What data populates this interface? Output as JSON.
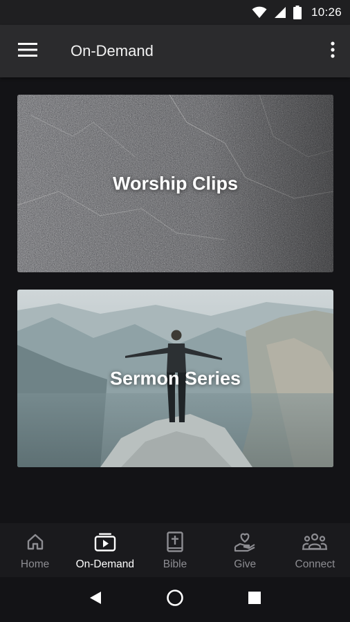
{
  "status_bar": {
    "time": "10:26",
    "icons": [
      "wifi-icon",
      "signal-icon",
      "battery-icon"
    ]
  },
  "app_bar": {
    "title": "On-Demand",
    "menu_icon": "hamburger-menu-icon",
    "overflow_icon": "more-vertical-icon"
  },
  "cards": [
    {
      "title": "Worship Clips"
    },
    {
      "title": "Sermon Series"
    }
  ],
  "bottom_nav": {
    "active": "On-Demand",
    "items": [
      {
        "label": "Home",
        "icon": "home-icon"
      },
      {
        "label": "On-Demand",
        "icon": "video-library-icon"
      },
      {
        "label": "Bible",
        "icon": "bible-icon"
      },
      {
        "label": "Give",
        "icon": "give-heart-hand-icon"
      },
      {
        "label": "Connect",
        "icon": "group-people-icon"
      }
    ]
  },
  "system_nav": [
    "back-icon",
    "home-circle-icon",
    "recents-square-icon"
  ],
  "colors": {
    "background": "#131316",
    "app_bar": "#2b2b2d",
    "nav_active": "#ffffff",
    "nav_inactive": "#8d8d92"
  }
}
